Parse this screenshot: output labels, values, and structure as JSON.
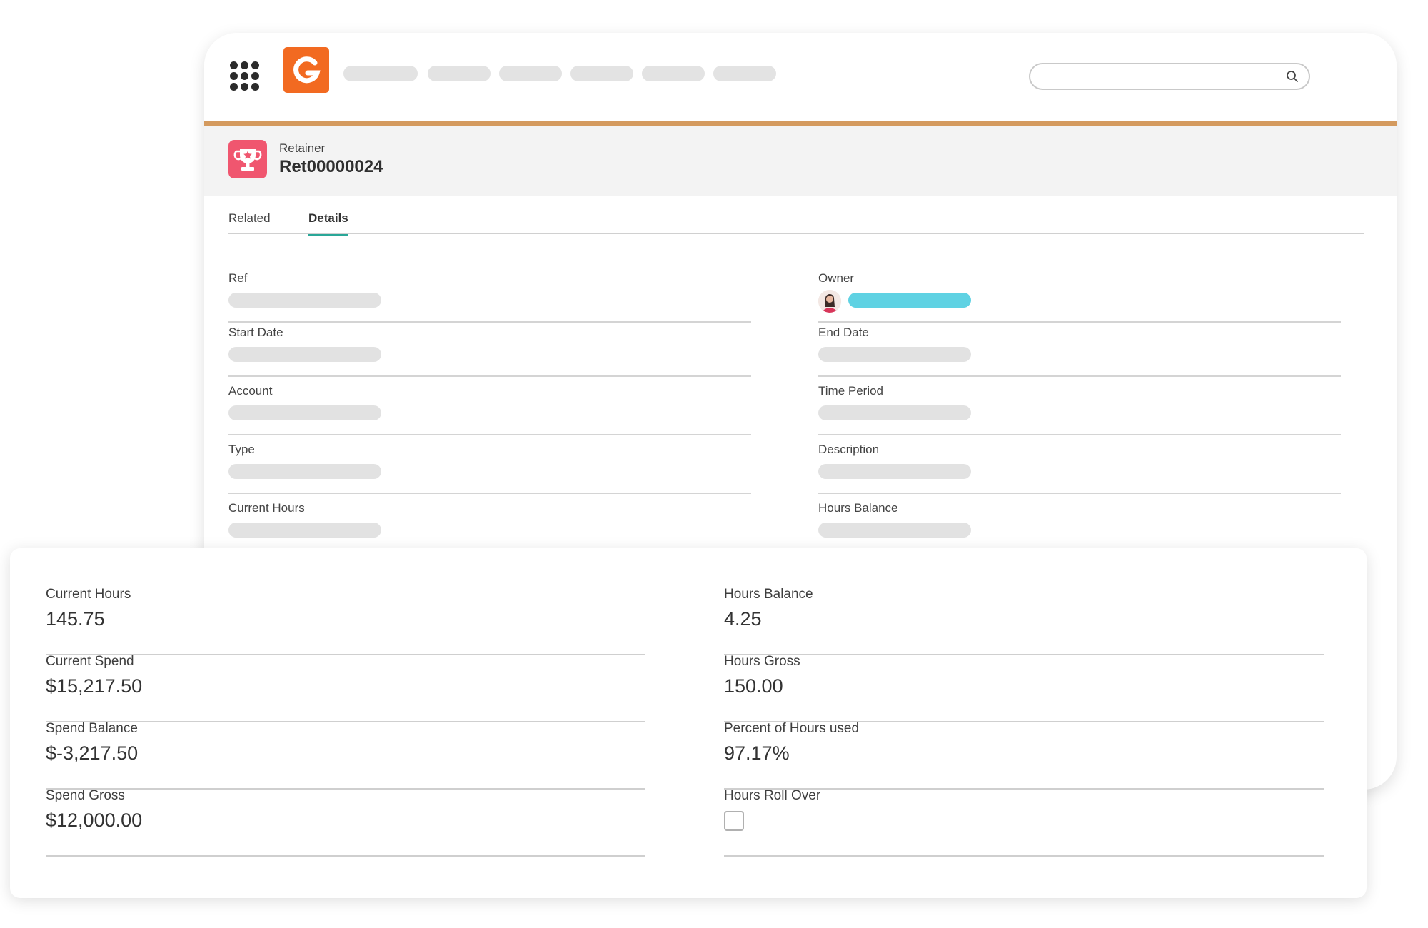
{
  "header": {
    "search": {
      "value": "",
      "placeholder": ""
    },
    "nav_items": [
      "",
      "",
      "",
      "",
      "",
      ""
    ]
  },
  "record": {
    "type_label": "Retainer",
    "name": "Ret00000024"
  },
  "tabs": [
    {
      "label": "Related",
      "active": false
    },
    {
      "label": "Details",
      "active": true
    }
  ],
  "details_left": [
    {
      "label": "Ref"
    },
    {
      "label": "Start Date"
    },
    {
      "label": "Account"
    },
    {
      "label": "Type"
    },
    {
      "label": "Current Hours"
    }
  ],
  "details_right": [
    {
      "label": "Owner"
    },
    {
      "label": "End Date"
    },
    {
      "label": "Time Period"
    },
    {
      "label": "Description"
    },
    {
      "label": "Hours Balance"
    }
  ],
  "summary": {
    "left": [
      {
        "label": "Current Hours",
        "value": "145.75"
      },
      {
        "label": "Current Spend",
        "value": "$15,217.50"
      },
      {
        "label": "Spend Balance",
        "value": "$-3,217.50"
      },
      {
        "label": "Spend Gross",
        "value": "$12,000.00"
      }
    ],
    "right": [
      {
        "label": "Hours Balance",
        "value": "4.25"
      },
      {
        "label": "Hours Gross",
        "value": "150.00"
      },
      {
        "label": "Percent of Hours used",
        "value": "97.17%"
      },
      {
        "label": "Hours Roll Over",
        "checked": false
      }
    ]
  },
  "colors": {
    "logo": "#f26a21",
    "accent_line": "#d49a5e",
    "record_icon": "#f0566f",
    "active_tab": "#2aa798",
    "owner_highlight": "#5fd2e3"
  },
  "icons": {
    "app_launcher": "grid-dots-icon",
    "logo": "g-logo-icon",
    "search": "search-icon",
    "record": "trophy-icon",
    "owner": "avatar-icon"
  }
}
